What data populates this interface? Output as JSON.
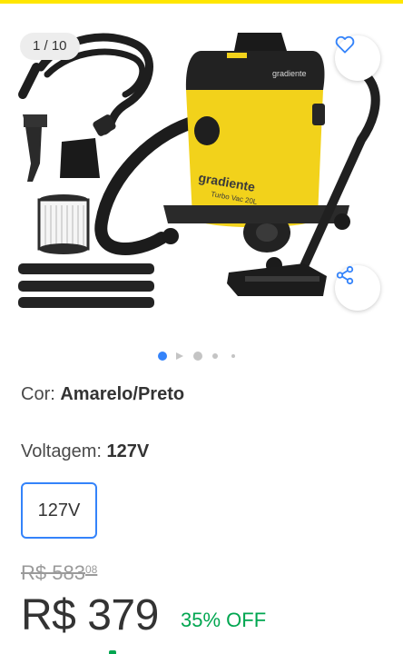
{
  "gallery": {
    "counter": "1 / 10",
    "total_slides": 10,
    "current_slide": 1,
    "product_image": "wet-dry-vacuum-cleaner",
    "product_brand_on_image": "gradiente",
    "product_label_on_image": "Turbo Vac 20L",
    "favorite_icon": "heart-outline-icon",
    "share_icon": "share-icon"
  },
  "variations": {
    "color_label": "Cor:",
    "color_value": "Amarelo/Preto",
    "voltage_label": "Voltagem:",
    "voltage_value": "127V",
    "voltage_options": [
      "127V"
    ]
  },
  "pricing": {
    "old_price_main": "R$ 583",
    "old_price_cents": "08",
    "price": "R$ 379",
    "discount": "35% OFF"
  },
  "colors": {
    "accent_blue": "#3483fa",
    "discount_green": "#00a650",
    "brand_yellow": "#ffe600",
    "product_yellow": "#f2d21b"
  }
}
